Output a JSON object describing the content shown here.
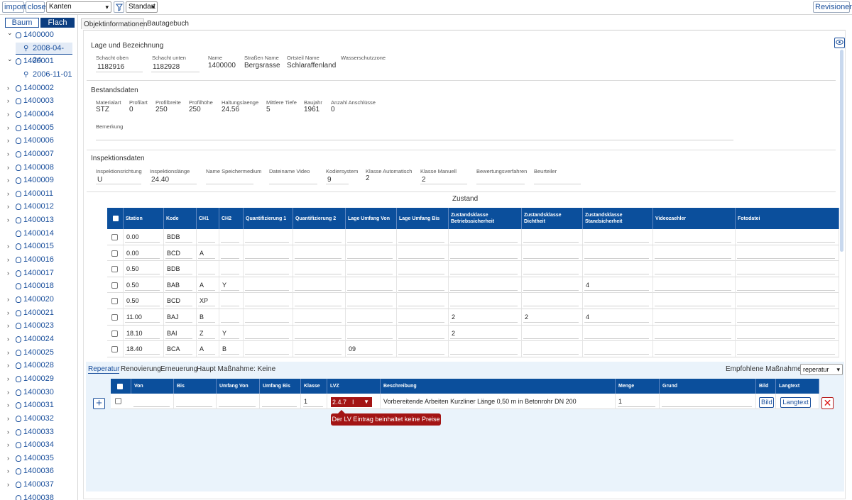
{
  "toolbar": {
    "import_label": "import",
    "close_label": "close",
    "layer_select": "Kanten",
    "filter_icon": "funnel-icon",
    "view_select": "Standart",
    "revisions_label": "Revisionen"
  },
  "sidebar": {
    "mode_tree": "Baum",
    "mode_flat": "Flach",
    "nodes": [
      {
        "id": "1400000",
        "expanded": true,
        "children": [
          "2008-04-24"
        ]
      },
      {
        "id": "1400001",
        "expanded": true,
        "children": [
          "2006-11-01"
        ]
      },
      {
        "id": "1400002",
        "expanded": false
      },
      {
        "id": "1400003",
        "expanded": false
      },
      {
        "id": "1400004",
        "expanded": false
      },
      {
        "id": "1400005",
        "expanded": false
      },
      {
        "id": "1400006",
        "expanded": false
      },
      {
        "id": "1400007",
        "expanded": false
      },
      {
        "id": "1400008",
        "expanded": false
      },
      {
        "id": "1400009",
        "expanded": false
      },
      {
        "id": "1400011",
        "expanded": false
      },
      {
        "id": "1400012",
        "expanded": false
      },
      {
        "id": "1400013",
        "expanded": false
      },
      {
        "id": "1400014",
        "leaf": true
      },
      {
        "id": "1400015",
        "expanded": false
      },
      {
        "id": "1400016",
        "expanded": false
      },
      {
        "id": "1400017",
        "expanded": false
      },
      {
        "id": "1400018",
        "leaf": true
      },
      {
        "id": "1400020",
        "expanded": false
      },
      {
        "id": "1400021",
        "expanded": false
      },
      {
        "id": "1400023",
        "expanded": false
      },
      {
        "id": "1400024",
        "expanded": false
      },
      {
        "id": "1400025",
        "expanded": false
      },
      {
        "id": "1400028",
        "expanded": false
      },
      {
        "id": "1400029",
        "expanded": false
      },
      {
        "id": "1400030",
        "expanded": false
      },
      {
        "id": "1400031",
        "expanded": false
      },
      {
        "id": "1400032",
        "expanded": false
      },
      {
        "id": "1400033",
        "expanded": false
      },
      {
        "id": "1400034",
        "expanded": false
      },
      {
        "id": "1400035",
        "expanded": false
      },
      {
        "id": "1400036",
        "expanded": false
      },
      {
        "id": "1400037",
        "expanded": false
      },
      {
        "id": "1400038",
        "leaf": true
      }
    ]
  },
  "tabs": [
    "Objektinformationen",
    "Bautagebuch"
  ],
  "lage": {
    "title": "Lage und Bezeichnung",
    "schacht_oben_label": "Schacht oben",
    "schacht_oben": "1182916",
    "schacht_unten_label": "Schacht unten",
    "schacht_unten": "1182928",
    "name_label": "Name",
    "name": "1400000",
    "strasse_label": "Straßen Name",
    "strasse": "Bergsrasse",
    "ortsteil_label": "Ortsteil Name",
    "ortsteil": "Schlaraffenland",
    "wasserschutz_label": "Wasserschutzzone"
  },
  "bestand": {
    "title": "Bestandsdaten",
    "fields": [
      {
        "label": "Materialart",
        "value": "STZ"
      },
      {
        "label": "Profilart",
        "value": "0"
      },
      {
        "label": "Profilbreite",
        "value": "250"
      },
      {
        "label": "Profilhöhe",
        "value": "250"
      },
      {
        "label": "Haltungslaenge",
        "value": "24.56"
      },
      {
        "label": "Mittlere Tiefe",
        "value": "5"
      },
      {
        "label": "Baujahr",
        "value": "1961"
      },
      {
        "label": "Anzahl Anschlüsse",
        "value": "0"
      }
    ],
    "bemerkung_label": "Bemerkung"
  },
  "inspektion": {
    "title": "Inspektionsdaten",
    "fields": [
      {
        "label": "Inspektionsrichtung",
        "value": "U"
      },
      {
        "label": "Inspektionslänge",
        "value": "24.40"
      },
      {
        "label": "Name Speichermedium",
        "value": ""
      },
      {
        "label": "Dateiname Video",
        "value": ""
      },
      {
        "label": "Kodiersystem",
        "value": "9"
      },
      {
        "label": "Klasse Automatisch",
        "value": "2"
      },
      {
        "label": "Klasse Manuell",
        "value": "2"
      },
      {
        "label": "Bewertungsverfahren",
        "value": ""
      },
      {
        "label": "Beurteiler",
        "value": ""
      }
    ]
  },
  "zustand": {
    "title": "Zustand",
    "columns": [
      "Station",
      "Kode",
      "CH1",
      "CH2",
      "Quantifizierung 1",
      "Quantifizierung 2",
      "Lage Umfang Von",
      "Lage Umfang Bis",
      "Zustandsklasse Betriebssicherheit",
      "Zustandsklasse Dichtheit",
      "Zustandsklasse Standsicherheit",
      "Videozaehler",
      "Fotodatei"
    ],
    "rows": [
      [
        "0.00",
        "BDB",
        "",
        "",
        "",
        "",
        "",
        "",
        "",
        "",
        "",
        "",
        ""
      ],
      [
        "0.00",
        "BCD",
        "A",
        "",
        "",
        "",
        "",
        "",
        "",
        "",
        "",
        "",
        ""
      ],
      [
        "0.50",
        "BDB",
        "",
        "",
        "",
        "",
        "",
        "",
        "",
        "",
        "",
        "",
        ""
      ],
      [
        "0.50",
        "BAB",
        "A",
        "Y",
        "",
        "",
        "",
        "",
        "",
        "",
        "4",
        "",
        ""
      ],
      [
        "0.50",
        "BCD",
        "XP",
        "",
        "",
        "",
        "",
        "",
        "",
        "",
        "",
        "",
        ""
      ],
      [
        "11.00",
        "BAJ",
        "B",
        "",
        "",
        "",
        "",
        "",
        "2",
        "2",
        "4",
        "",
        ""
      ],
      [
        "18.10",
        "BAI",
        "Z",
        "Y",
        "",
        "",
        "",
        "",
        "2",
        "",
        "",
        "",
        ""
      ],
      [
        "18.40",
        "BCA",
        "A",
        "B",
        "",
        "",
        "09",
        "",
        "",
        "",
        "",
        "",
        ""
      ]
    ]
  },
  "massnahme": {
    "tabs": [
      "Reperatur",
      "Renovierung",
      "Erneuerung"
    ],
    "haupt": "Haupt Maßnahme: Keine",
    "empfohlen_label": "Empfohlene Maßnahme:",
    "empfohlen_value": "reperatur",
    "columns": [
      "Von",
      "Bis",
      "Umfang Von",
      "Umfang Bis",
      "Klasse",
      "LVZ",
      "Beschreibung",
      "Menge",
      "Grund",
      "Bild",
      "Langtext"
    ],
    "row": {
      "von": "",
      "bis": "",
      "umfang_von": "",
      "umfang_bis": "",
      "klasse": "1",
      "lvz": "2.4.7",
      "beschreibung": "Vorbereitende Arbeiten Kurzliner Länge 0,50 m in Betonrohr DN 200",
      "menge": "1",
      "grund": "",
      "bild_button": "Bild",
      "langtext_button": "Langtext"
    },
    "tooltip": "Der LV Eintrag beinhaltet keine Preise"
  },
  "colors": {
    "header_blue": "#0b4f9c",
    "error_red": "#a31414",
    "link_blue": "#1a4f9c"
  }
}
